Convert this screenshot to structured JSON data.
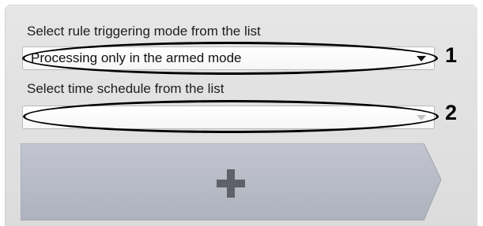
{
  "rule_mode": {
    "label": "Select rule triggering mode from the list",
    "selected": "Processing only in the armed mode"
  },
  "schedule": {
    "label": "Select time schedule from the list",
    "selected": ""
  },
  "callouts": [
    "1",
    "2"
  ],
  "add_button": {
    "icon": "plus-icon"
  },
  "colors": {
    "panel": "#dcdcdc",
    "button_fill": "#b5b9c4",
    "plus": "#5f6168"
  }
}
